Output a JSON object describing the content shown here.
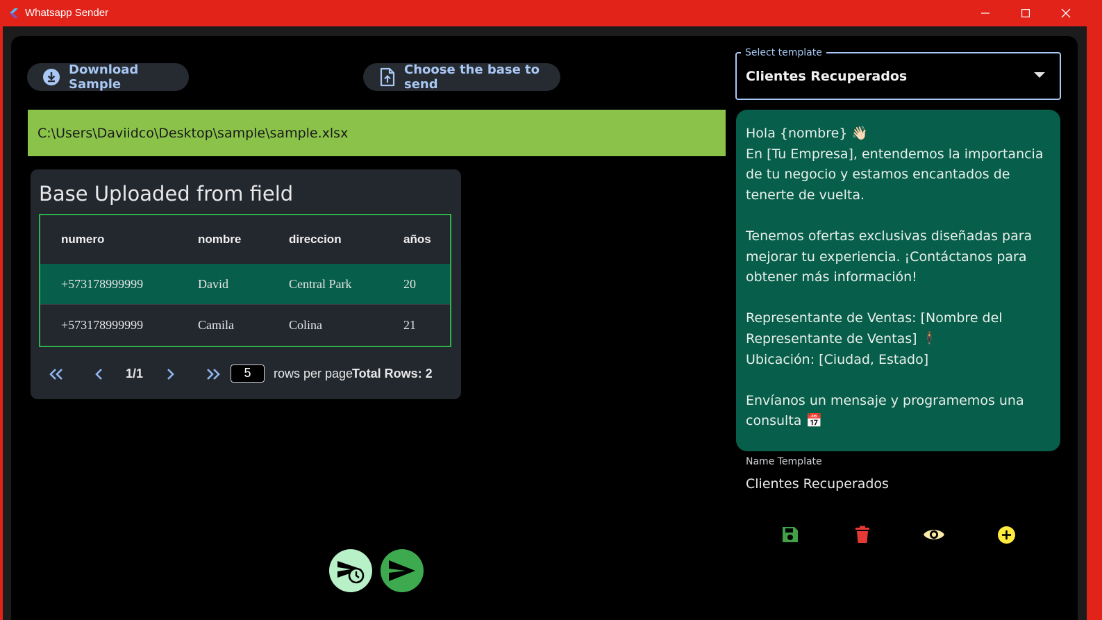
{
  "window": {
    "title": "Whatsapp Sender",
    "accent": "#e2231a"
  },
  "toolbar": {
    "download_label": "Download Sample",
    "choose_label": "Choose the base to send"
  },
  "file": {
    "path": "C:\\Users\\Daviidco\\Desktop\\sample\\sample.xlsx"
  },
  "table_card": {
    "title": "Base Uploaded from field",
    "columns": [
      "numero",
      "nombre",
      "direccion",
      "años"
    ],
    "rows": [
      [
        "+573178999999",
        "David",
        "Central Park",
        "20"
      ],
      [
        "+573178999999",
        "Camila",
        "Colina",
        "21"
      ]
    ],
    "pager": {
      "page": "1/1",
      "rows_per_page": "5",
      "rows_per_page_label": "rows per page",
      "total_label": "Total Rows: 2"
    }
  },
  "template_select": {
    "legend": "Select template",
    "value": "Clientes Recuperados"
  },
  "message": {
    "line1": "Hola {nombre} 👋🏻",
    "line2": "En [Tu Empresa], entendemos la importancia de tu negocio y estamos encantados de tenerte de vuelta.",
    "line3": "Tenemos ofertas exclusivas diseñadas para mejorar tu experiencia. ¡Contáctanos para obtener más información!",
    "line4": "Representante de Ventas: [Nombre del Representante de Ventas] 🕴",
    "line5": "Ubicación: [Ciudad, Estado]",
    "line6": "Envíanos un mensaje y programemos una consulta 📅"
  },
  "name_template": {
    "label": "Name Template",
    "value": "Clientes Recuperados"
  },
  "actions": {
    "save_icon": "save-icon",
    "delete_icon": "trash-icon",
    "preview_icon": "eye-icon",
    "add_icon": "plus-circle-icon"
  },
  "colors": {
    "message_bg": "#075e4a",
    "path_bar": "#8bc34a",
    "table_border": "#2fb24b",
    "save": "#43a047",
    "delete": "#e53935",
    "preview": "#fbe9a8",
    "add": "#ffeb3b"
  }
}
